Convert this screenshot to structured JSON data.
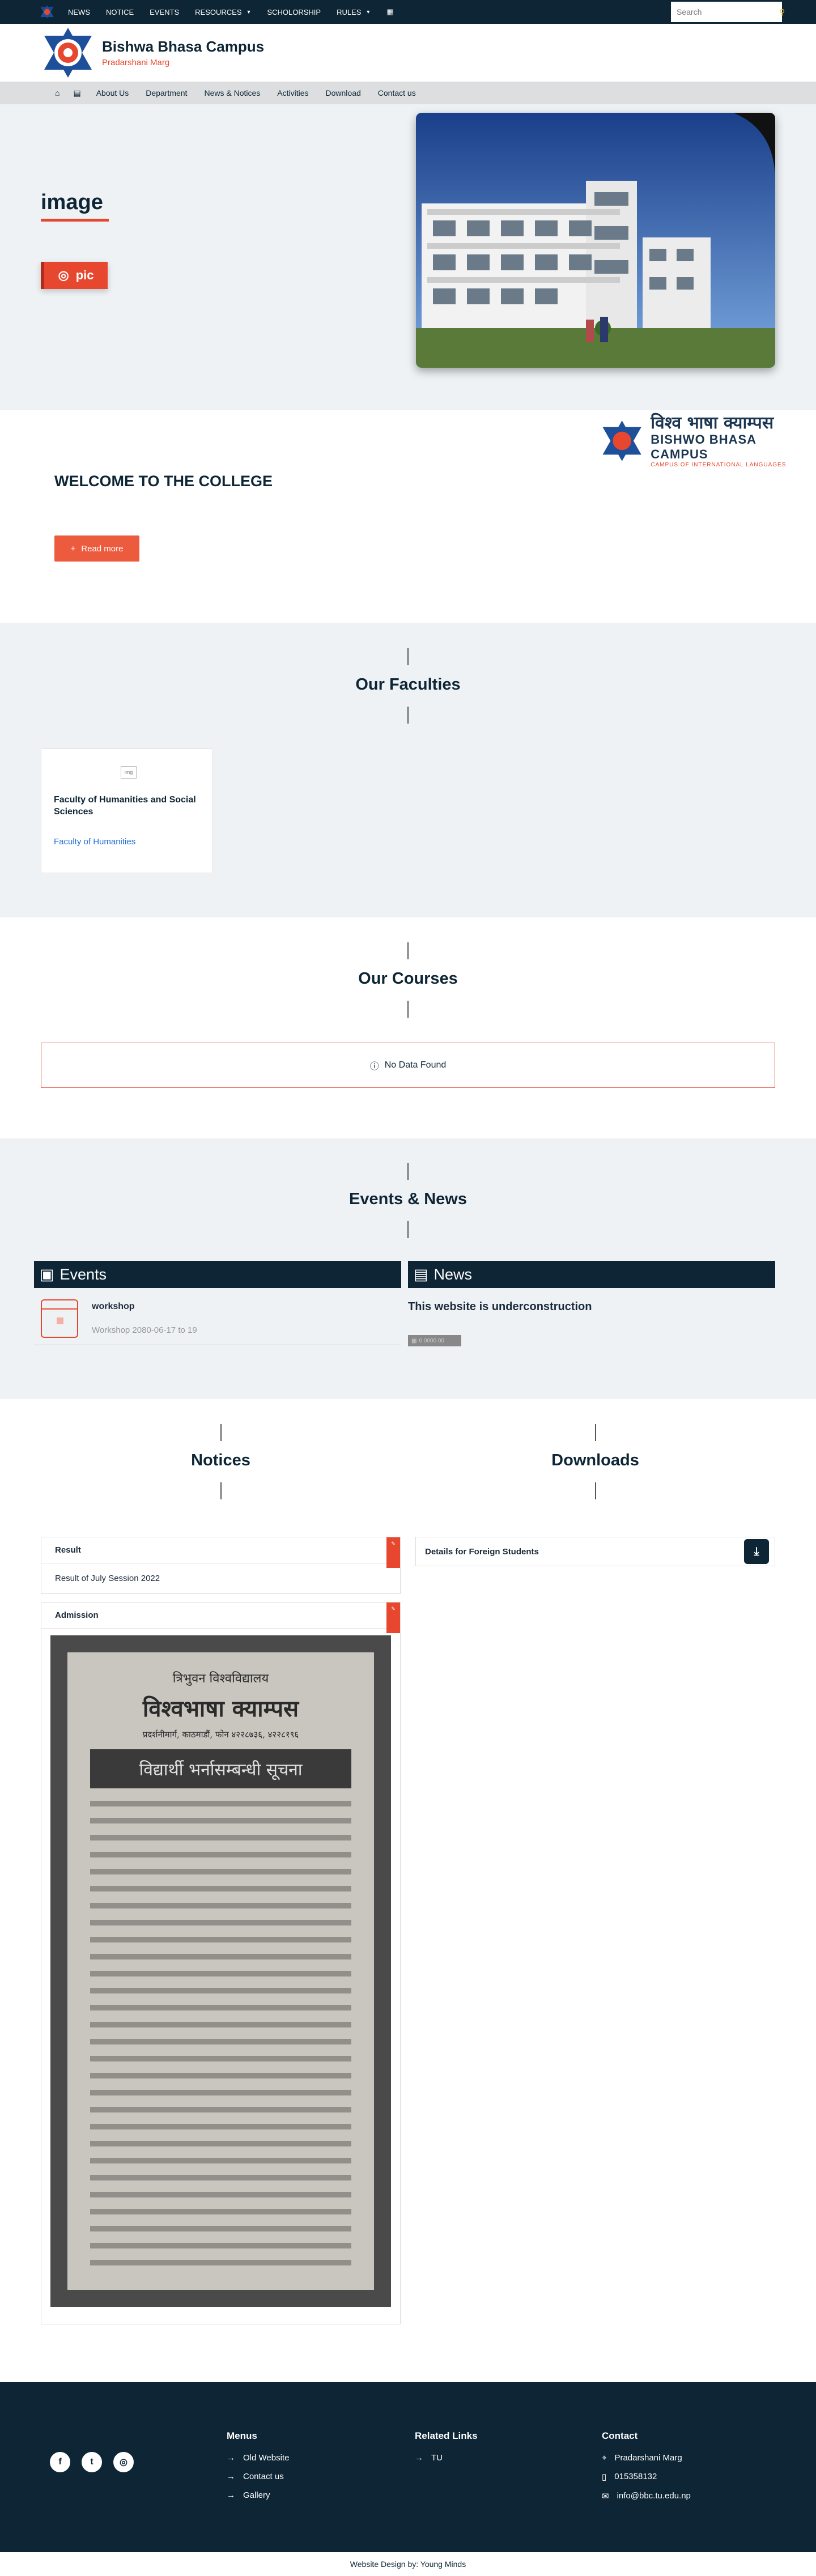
{
  "topnav": {
    "items": [
      {
        "label": "NEWS"
      },
      {
        "label": "NOTICE"
      },
      {
        "label": "EVENTS"
      },
      {
        "label": "RESOURCES"
      },
      {
        "label": "SCHOLORSHIP"
      },
      {
        "label": "RULES"
      }
    ],
    "search_placeholder": "Search"
  },
  "header": {
    "title": "Bishwa Bhasa Campus",
    "subtitle": "Pradarshani Marg"
  },
  "mainnav": {
    "items": [
      "About Us",
      "Department",
      "News & Notices",
      "Activities",
      "Download",
      "Contact us"
    ]
  },
  "hero": {
    "title": "image",
    "button": "pic"
  },
  "welcome": {
    "brand_nepali": "विश्व भाषा क्याम्पस",
    "brand_english": "BISHWO BHASA CAMPUS",
    "brand_tag": "CAMPUS OF INTERNATIONAL LANGUAGES",
    "title": "WELCOME TO THE COLLEGE",
    "read_more": "Read more"
  },
  "faculties": {
    "title": "Our Faculties",
    "card_img_alt": "img",
    "card_title": "Faculty of Humanities and Social Sciences",
    "card_link": "Faculty of Humanities"
  },
  "courses": {
    "title": "Our Courses",
    "empty": "No Data Found"
  },
  "events": {
    "title": "Events & News",
    "events_head": "Events",
    "news_head": "News",
    "event_title": "workshop",
    "event_desc": "Workshop 2080-06-17 to 19",
    "news_title": "This website is underconstruction",
    "news_date": "0 0000 00"
  },
  "notices": {
    "title": "Notices",
    "downloads_title": "Downloads",
    "items": [
      {
        "head": "Result",
        "body": "Result of July Session 2022"
      },
      {
        "head": "Admission"
      }
    ],
    "paper": {
      "l1": "त्रिभुवन विश्वविद्यालय",
      "l2": "विश्वभाषा क्याम्पस",
      "l3": "प्रदर्शनीमार्ग, काठमाडौं, फोन ४२२८७३६, ४२२८१९६",
      "l4": "विद्यार्थी भर्नासम्बन्धी सूचना"
    },
    "download_item": "Details for Foreign Students"
  },
  "footer": {
    "menus_head": "Menus",
    "menus": [
      "Old Website",
      "Contact us",
      "Gallery"
    ],
    "links_head": "Related Links",
    "links": [
      "TU"
    ],
    "contact_head": "Contact",
    "contact": [
      "Pradarshani Marg",
      "015358132",
      "info@bbc.tu.edu.np"
    ],
    "copyright": "Website Design by: Young Minds"
  },
  "colors": {
    "primary": "#0d2535",
    "accent": "#e8472f"
  }
}
